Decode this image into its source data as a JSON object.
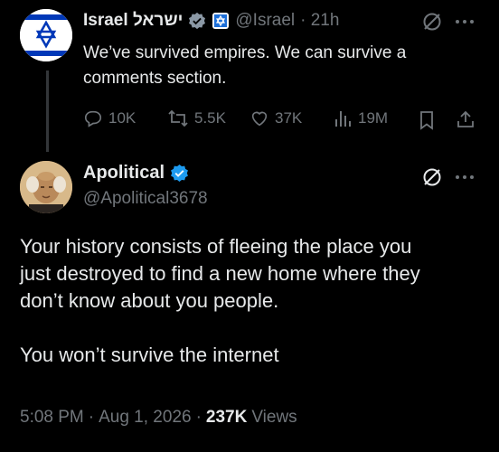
{
  "tweet1": {
    "name": "Israel ישראל",
    "handle": "@Israel",
    "time": "· 21h",
    "text_line1": "We’ve survived empires. We can survive a",
    "text_line2": "comments section.",
    "replies": "10K",
    "retweets": "5.5K",
    "likes": "37K",
    "views": "19M"
  },
  "tweet2": {
    "name": "Apolitical",
    "handle": "@Apolitical3678",
    "body_lines": [
      "Your history consists of fleeing the place you",
      "just destroyed to find a new home where they",
      "don’t know about you people.",
      "",
      "You won’t survive the internet"
    ],
    "meta": {
      "time": "5:08 PM",
      "date": "Aug 1, 2026",
      "views_count": "237K",
      "views_label": "Views"
    }
  },
  "icons": {
    "verified": "verified-badge-icon",
    "gov": "government-affiliation-icon",
    "grok": "grok-icon",
    "more": "more-icon"
  },
  "colors": {
    "background": "#000000",
    "text": "#e7e9ea",
    "muted": "#71767b",
    "verified_blue": "#1d9bf0",
    "israel_blue": "#0038b8"
  }
}
